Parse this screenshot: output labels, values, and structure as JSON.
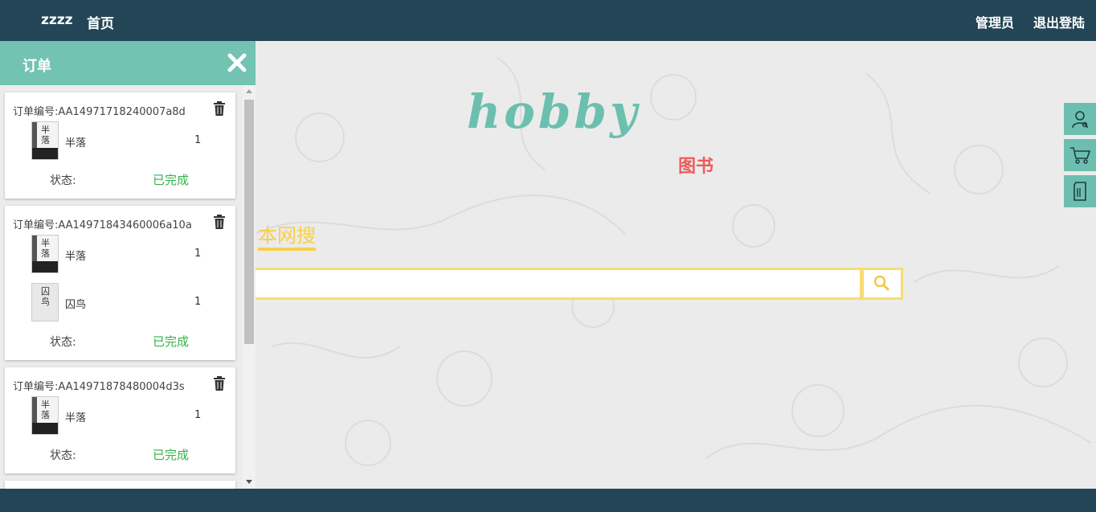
{
  "nav": {
    "brand": "zzzz",
    "home": "首页",
    "admin": "管理员",
    "logout": "退出登陆"
  },
  "hero": {
    "logo": "hobby",
    "category": "图书",
    "search_tab": "本网搜",
    "search_placeholder": ""
  },
  "side_tools": [
    {
      "icon": "user-settings-icon"
    },
    {
      "icon": "cart-icon"
    },
    {
      "icon": "order-document-icon"
    }
  ],
  "panel": {
    "title": "订单",
    "orders": [
      {
        "id_label": "订单编号:AA14971718240007a8d",
        "items": [
          {
            "name": "半落",
            "qty": "1",
            "cover_text": "半落"
          }
        ],
        "status_label": "状态:",
        "status_value": "已完成"
      },
      {
        "id_label": "订单编号:AA14971843460006a10a",
        "items": [
          {
            "name": "半落",
            "qty": "1",
            "cover_text": "半落"
          },
          {
            "name": "囚鸟",
            "qty": "1",
            "cover_text": "囚鸟"
          }
        ],
        "status_label": "状态:",
        "status_value": "已完成"
      },
      {
        "id_label": "订单编号:AA14971878480004d3s",
        "items": [
          {
            "name": "半落",
            "qty": "1",
            "cover_text": "半落"
          }
        ],
        "status_label": "状态:",
        "status_value": "已完成"
      }
    ]
  },
  "colors": {
    "nav_bg": "#234556",
    "accent": "#72c3b1",
    "search_accent": "#f7cf4b",
    "category": "#ef5a5a",
    "status_done": "#33b24a"
  }
}
